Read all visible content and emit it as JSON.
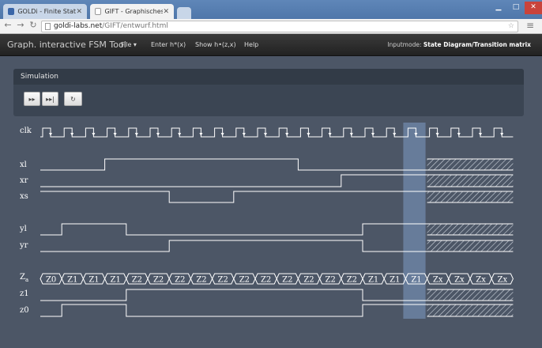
{
  "browser": {
    "tabs": [
      {
        "title": "GOLDi - Finite State Machi",
        "active": false
      },
      {
        "title": "GIFT - Graphisches interak",
        "active": true
      }
    ],
    "url_host": "goldi-labs.net",
    "url_path": "/GIFT/entwurf.html"
  },
  "navbar": {
    "brand": "Graph. interactive FSM Tool",
    "items": [
      "File ▾",
      "Enter h*(x)",
      "Show h•(z,x)",
      "Help"
    ],
    "inputmode_label": "Inputmode:",
    "inputmode_value": "State Diagram/Transition matrix"
  },
  "simulation": {
    "title": "Simulation",
    "buttons": [
      "step-forward",
      "fast-forward",
      "reset"
    ]
  },
  "signals": {
    "clk": "clk",
    "xl": "xl",
    "xr": "xr",
    "xs": "xs",
    "yl": "yl",
    "yr": "yr",
    "za_main": "Z",
    "za_sub": "a",
    "z1": "z1",
    "z0": "z0"
  },
  "timing": {
    "num_slots": 22,
    "highlight_slot": 17,
    "unknown_from": 18,
    "xl": [
      0,
      0,
      0,
      1,
      1,
      1,
      1,
      1,
      1,
      1,
      1,
      1,
      0,
      0,
      0,
      0,
      0,
      0
    ],
    "xr": [
      0,
      0,
      0,
      0,
      0,
      0,
      0,
      0,
      0,
      0,
      0,
      0,
      0,
      0,
      1,
      1,
      1,
      1
    ],
    "xs": [
      1,
      1,
      1,
      1,
      1,
      1,
      0,
      0,
      0,
      1,
      1,
      1,
      1,
      1,
      1,
      1,
      1,
      1
    ],
    "yl": [
      0,
      1,
      1,
      1,
      0,
      0,
      0,
      0,
      0,
      0,
      0,
      0,
      0,
      0,
      0,
      1,
      1,
      1
    ],
    "yr": [
      0,
      0,
      0,
      0,
      0,
      0,
      1,
      1,
      1,
      1,
      1,
      1,
      1,
      1,
      1,
      0,
      0,
      0
    ],
    "z1": [
      0,
      0,
      0,
      0,
      1,
      1,
      1,
      1,
      1,
      1,
      1,
      1,
      1,
      1,
      1,
      0,
      0,
      0
    ],
    "z0": [
      0,
      1,
      1,
      1,
      0,
      0,
      0,
      0,
      0,
      0,
      0,
      0,
      0,
      0,
      0,
      1,
      1,
      1
    ],
    "states": [
      "Z0",
      "Z1",
      "Z1",
      "Z1",
      "Z2",
      "Z2",
      "Z2",
      "Z2",
      "Z2",
      "Z2",
      "Z2",
      "Z2",
      "Z2",
      "Z2",
      "Z2",
      "Z1",
      "Z1",
      "Z1",
      "Zx",
      "Zx",
      "Zx",
      "Zx"
    ]
  },
  "colors": {
    "signal": "#ffffff",
    "highlight": "#7d9cc4",
    "hatch": "#cfd6df"
  }
}
